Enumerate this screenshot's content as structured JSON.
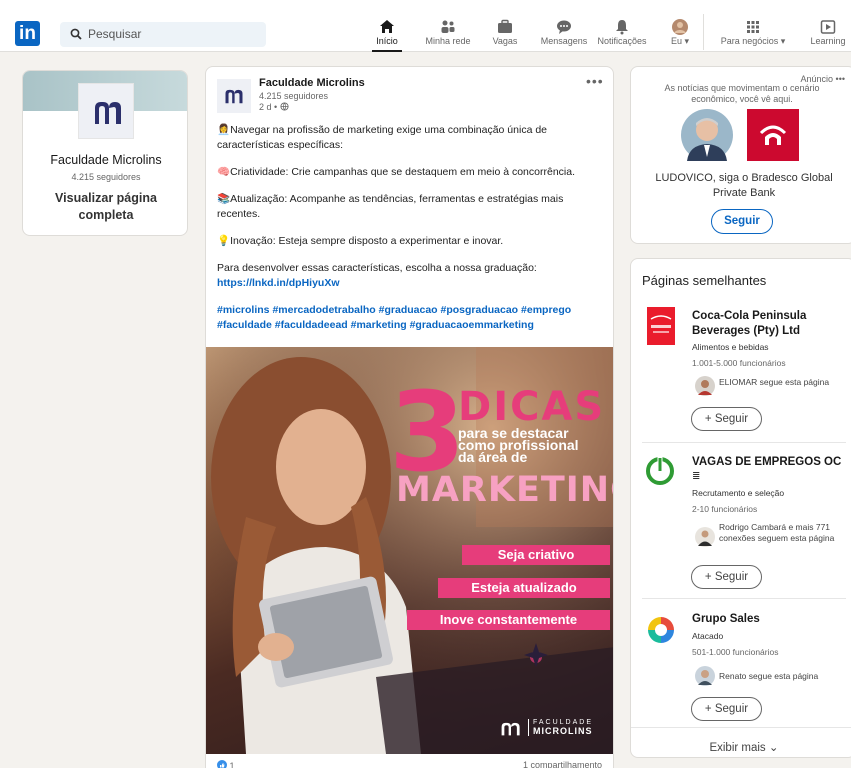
{
  "nav": {
    "search_placeholder": "Pesquisar",
    "items": [
      {
        "label": "Início",
        "icon": "home-icon"
      },
      {
        "label": "Minha rede",
        "icon": "network-icon"
      },
      {
        "label": "Vagas",
        "icon": "briefcase-icon"
      },
      {
        "label": "Mensagens",
        "icon": "messaging-icon"
      },
      {
        "label": "Notificações",
        "icon": "bell-icon"
      },
      {
        "label": "Eu",
        "icon": "avatar"
      },
      {
        "label": "Para negócios",
        "icon": "grid-icon"
      },
      {
        "label": "Learning",
        "icon": "play-icon"
      }
    ]
  },
  "left_card": {
    "name": "Faculdade Microlins",
    "followers": "4.215 seguidores",
    "view_page": "Visualizar página completa"
  },
  "post": {
    "author": "Faculdade Microlins",
    "followers": "4.215 seguidores",
    "time": "2 d •",
    "paragraphs": [
      "👩‍💼Navegar na profissão de marketing exige uma combinação única de características específicas:",
      "🧠Criatividade: Crie campanhas que se destaquem em meio à concorrência.",
      "📚Atualização: Acompanhe as tendências, ferramentas e estratégias mais recentes.",
      "💡Inovação: Esteja sempre disposto a experimentar e inovar."
    ],
    "cta_text": "Para desenvolver essas características, escolha a nossa graduação: ",
    "cta_link": "https://lnkd.in/dpHiyuXw",
    "hashtags": "#microlins #mercadodetrabalho #graduacao #posgraduacao #emprego #faculdade #faculdadeead #marketing #graduacaoemmarketing",
    "image": {
      "big_number": "3",
      "title": "DICAS",
      "subtitle_lines": [
        "para se destacar",
        "como profissional",
        "da área de"
      ],
      "headline": "MARKETING",
      "tips": [
        "Seja criativo",
        "Esteja atualizado",
        "Inove constantemente"
      ],
      "brand_top": "FACULDADE",
      "brand_bottom": "MICROLINS"
    },
    "reactions": "1",
    "shares": "1 compartilhamento"
  },
  "ad": {
    "label": "Anúncio",
    "text": "As notícias que movimentam o cenário econômico, você vê aqui.",
    "headline": "LUDOVICO, siga o Bradesco Global Private Bank",
    "button": "Seguir"
  },
  "similar": {
    "title": "Páginas semelhantes",
    "pages": [
      {
        "name": "Coca-Cola Peninsula Beverages (Pty) Ltd",
        "industry": "Alimentos e bebidas",
        "size": "1.001-5.000 funcionários",
        "connection": "ELIOMAR segue esta página",
        "button": "+ Seguir"
      },
      {
        "name": "VAGAS DE EMPREGOS OC",
        "industry": "Recrutamento e seleção",
        "size": "2-10 funcionários",
        "connection": "Rodrigo Cambará e mais 771 conexões seguem esta página",
        "button": "+ Seguir"
      },
      {
        "name": "Grupo Sales",
        "industry": "Atacado",
        "size": "501-1.000 funcionários",
        "connection": "Renato segue esta página",
        "button": "+ Seguir"
      }
    ],
    "show_more": "Exibir mais"
  },
  "colors": {
    "brand_blue": "#0a66c2",
    "pink": "#e63d7b",
    "background": "#f4f2ee"
  }
}
